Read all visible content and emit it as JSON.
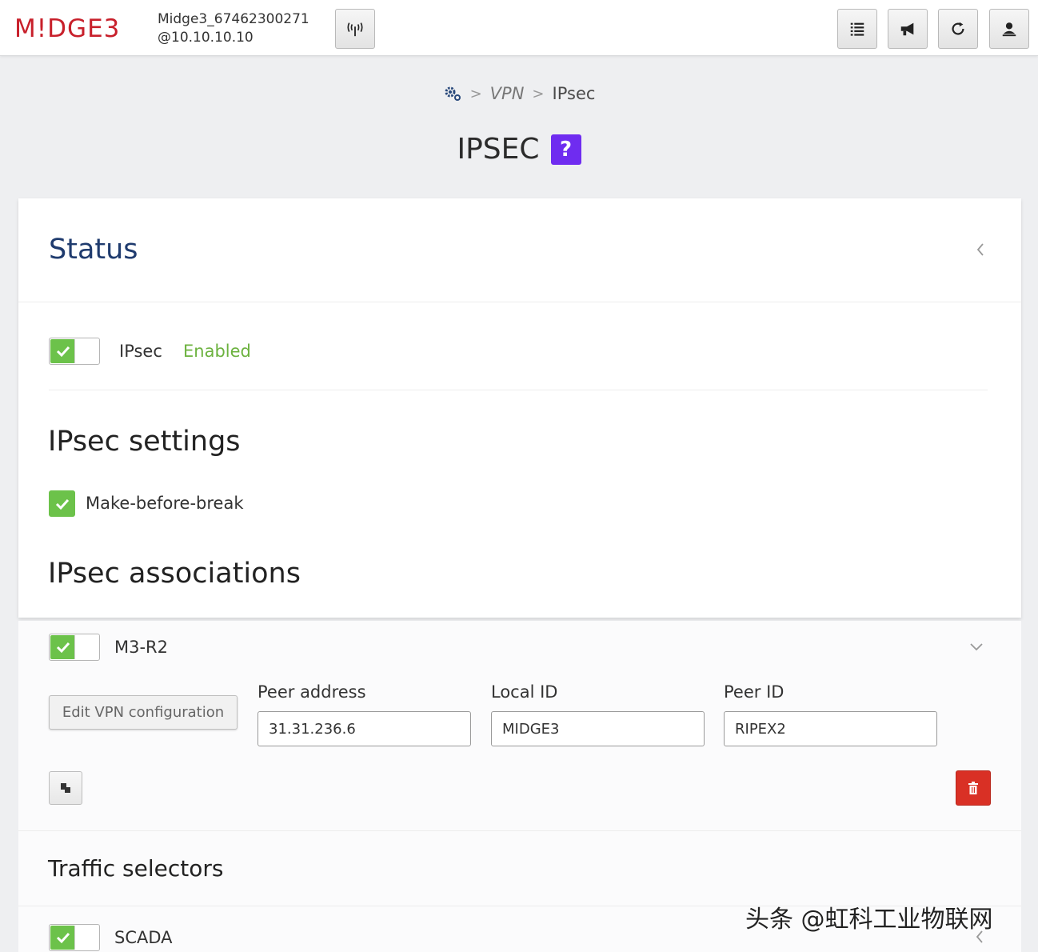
{
  "header": {
    "logo": "M!DGE3",
    "device_name": "Midge3_67462300271",
    "device_ip": "@10.10.10.10",
    "buttons": [
      {
        "icon": "antenna-icon"
      },
      {
        "icon": "list-icon"
      },
      {
        "icon": "megaphone-icon"
      },
      {
        "icon": "refresh-icon"
      },
      {
        "icon": "user-logout-icon"
      }
    ]
  },
  "breadcrumb": {
    "home_icon": "gears-icon",
    "items": [
      "VPN",
      "IPsec"
    ]
  },
  "page": {
    "title": "IPSEC",
    "help_label": "?"
  },
  "status": {
    "title": "Status",
    "ipsec_label": "IPsec",
    "ipsec_state": "Enabled"
  },
  "settings": {
    "title": "IPsec settings",
    "make_before_break_label": "Make-before-break",
    "make_before_break_checked": true
  },
  "associations": {
    "title": "IPsec associations",
    "items": [
      {
        "name": "M3-R2",
        "enabled": true,
        "edit_label": "Edit VPN configuration",
        "peer_address_label": "Peer address",
        "peer_address": "31.31.236.6",
        "local_id_label": "Local ID",
        "local_id": "MIDGE3",
        "peer_id_label": "Peer ID",
        "peer_id": "RIPEX2"
      }
    ]
  },
  "traffic_selectors": {
    "title": "Traffic selectors",
    "items": [
      {
        "name": "SCADA",
        "enabled": true
      }
    ]
  },
  "watermark": "头条 @虹科工业物联网",
  "colors": {
    "brand": "#c8202b",
    "status_title": "#1f3b6e",
    "enabled_green": "#6cb23f",
    "help_purple": "#6f2cf0",
    "delete_red": "#d93025"
  }
}
